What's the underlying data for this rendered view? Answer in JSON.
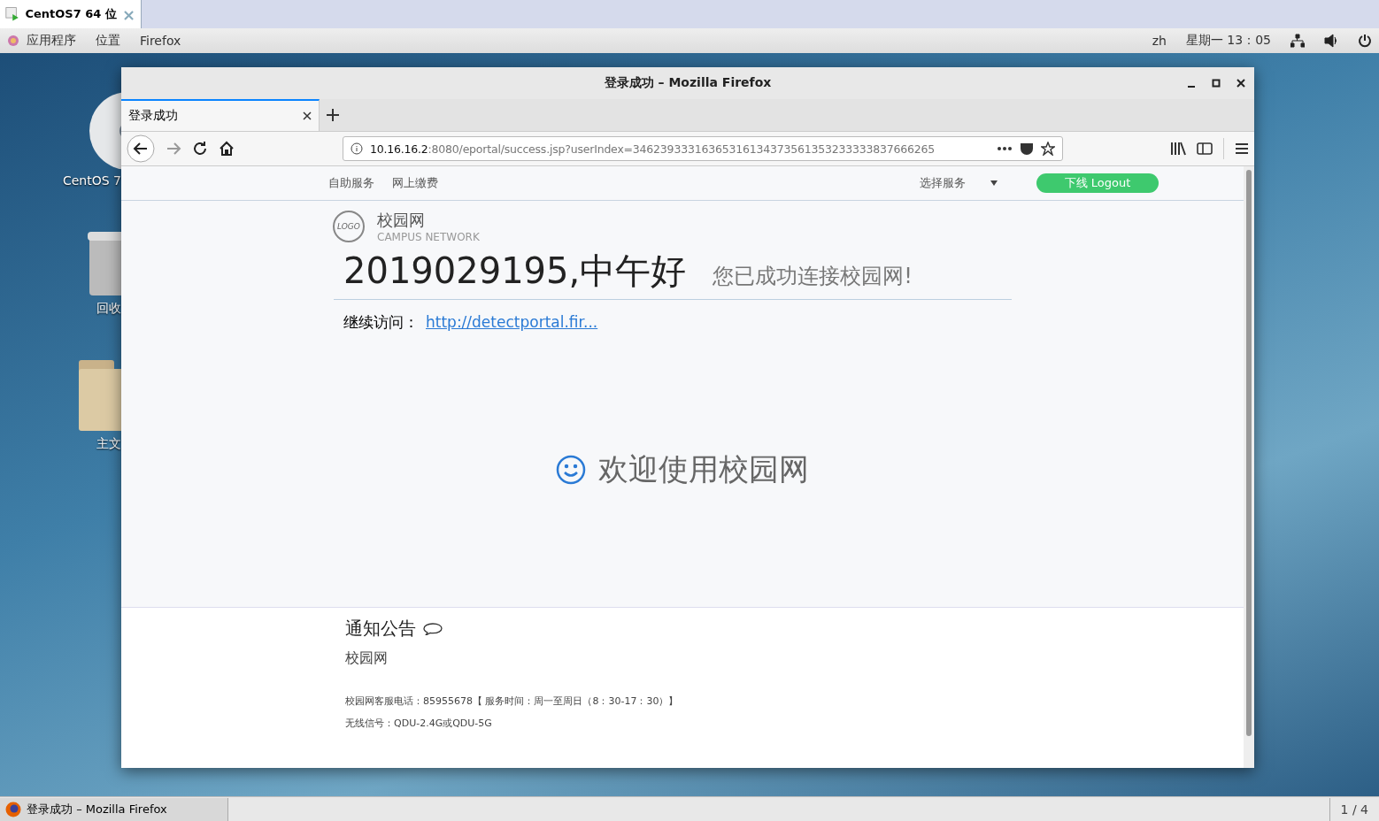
{
  "vm_tab": {
    "title": "CentOS7 64 位",
    "close": "×"
  },
  "top_bar": {
    "menus": [
      "应用程序",
      "位置",
      "Firefox"
    ],
    "input_method": "zh",
    "clock": "星期一 13：05"
  },
  "desktop_icons": [
    {
      "kind": "disc",
      "label": "CentOS 7"
    },
    {
      "kind": "trash",
      "label": "回收"
    },
    {
      "kind": "folder",
      "label": "主文"
    }
  ],
  "window": {
    "title": "登录成功 – Mozilla Firefox"
  },
  "browser": {
    "tabs": [
      {
        "label": "登录成功",
        "selected": true
      }
    ],
    "url_host": "10.16.16.2",
    "url_rest": ":8080/eportal/success.jsp?userIndex=34623933316365316134373561353233333837666265"
  },
  "page": {
    "nav": [
      "自助服务",
      "网上缴费"
    ],
    "service_select": "选择服务",
    "logout_button": "下线 Logout",
    "logo_text": "LOGO",
    "brand": "校园网",
    "brand_sub": "CAMPUS NETWORK",
    "greeting": "2019029195,中午好",
    "connected": "您已成功连接校园网!",
    "continue_label": "继续访问：",
    "continue_link": "http://detectportal.fir...",
    "welcome": "欢迎使用校园网",
    "notice_title": "通知公告",
    "notice_body": "校园网",
    "footer": [
      "校园网客服电话：85955678【 服务时间：周一至周日（8：30-17：30）】",
      "无线信号：QDU-2.4G或QDU-5G"
    ]
  },
  "taskbar": {
    "item": "登录成功 – Mozilla Firefox",
    "workspace": "1 / 4"
  }
}
